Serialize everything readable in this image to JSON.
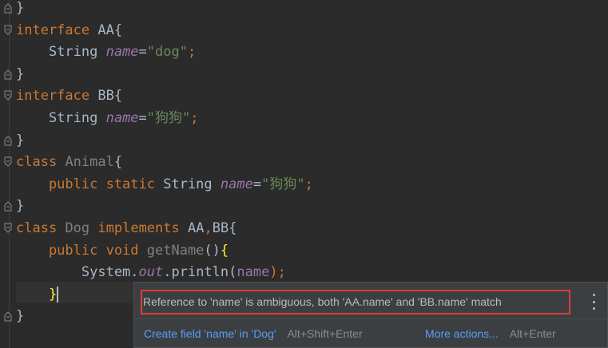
{
  "editor": {
    "lines": [
      [
        {
          "t": "}",
          "c": "paren"
        }
      ],
      [
        {
          "t": "interface",
          "c": "kw"
        },
        {
          "t": " AA{",
          "c": "type"
        }
      ],
      [
        {
          "t": "    String ",
          "c": "type"
        },
        {
          "t": "name",
          "c": "field"
        },
        {
          "t": "=",
          "c": "type"
        },
        {
          "t": "\"dog\"",
          "c": "str"
        },
        {
          "t": ";",
          "c": "punct"
        }
      ],
      [
        {
          "t": "}",
          "c": "paren"
        }
      ],
      [
        {
          "t": "interface",
          "c": "kw"
        },
        {
          "t": " BB{",
          "c": "type"
        }
      ],
      [
        {
          "t": "    String ",
          "c": "type"
        },
        {
          "t": "name",
          "c": "field"
        },
        {
          "t": "=",
          "c": "type"
        },
        {
          "t": "\"狗狗\"",
          "c": "str"
        },
        {
          "t": ";",
          "c": "punct"
        }
      ],
      [
        {
          "t": "}",
          "c": "paren"
        }
      ],
      [
        {
          "t": "class",
          "c": "kw"
        },
        {
          "t": " ",
          "c": "type"
        },
        {
          "t": "Animal",
          "c": "ident-dim"
        },
        {
          "t": "{",
          "c": "type"
        }
      ],
      [
        {
          "t": "    public static ",
          "c": "kw"
        },
        {
          "t": "String ",
          "c": "type"
        },
        {
          "t": "name",
          "c": "static-field"
        },
        {
          "t": "=",
          "c": "type"
        },
        {
          "t": "\"狗狗\"",
          "c": "str"
        },
        {
          "t": ";",
          "c": "punct"
        }
      ],
      [
        {
          "t": "}",
          "c": "paren"
        }
      ],
      [
        {
          "t": "class",
          "c": "kw"
        },
        {
          "t": " ",
          "c": "type"
        },
        {
          "t": "Dog",
          "c": "ident-dim"
        },
        {
          "t": " implements ",
          "c": "kw"
        },
        {
          "t": "AA",
          "c": "type"
        },
        {
          "t": ",",
          "c": "punct"
        },
        {
          "t": "BB{",
          "c": "type"
        }
      ],
      [
        {
          "t": "    public void ",
          "c": "kw"
        },
        {
          "t": "getName",
          "c": "ident-dim"
        },
        {
          "t": "()",
          "c": "paren"
        },
        {
          "t": "{",
          "c": "brace-hl"
        }
      ],
      [
        {
          "t": "        System.",
          "c": "type"
        },
        {
          "t": "out",
          "c": "static-field"
        },
        {
          "t": ".println(",
          "c": "type"
        },
        {
          "t": "name",
          "c": "field-plain"
        },
        {
          "t": ");",
          "c": "punct"
        }
      ],
      [
        {
          "t": "    ",
          "c": "type"
        },
        {
          "t": "}",
          "c": "brace-hl"
        }
      ],
      [
        {
          "t": "}",
          "c": "paren"
        }
      ]
    ]
  },
  "popup": {
    "message": "Reference to 'name' is ambiguous, both 'AA.name' and 'BB.name' match",
    "action1_label": "Create field 'name' in 'Dog'",
    "action1_shortcut": "Alt+Shift+Enter",
    "action2_label": "More actions...",
    "action2_shortcut": "Alt+Enter",
    "menu_icon": "more-vertical-icon"
  }
}
